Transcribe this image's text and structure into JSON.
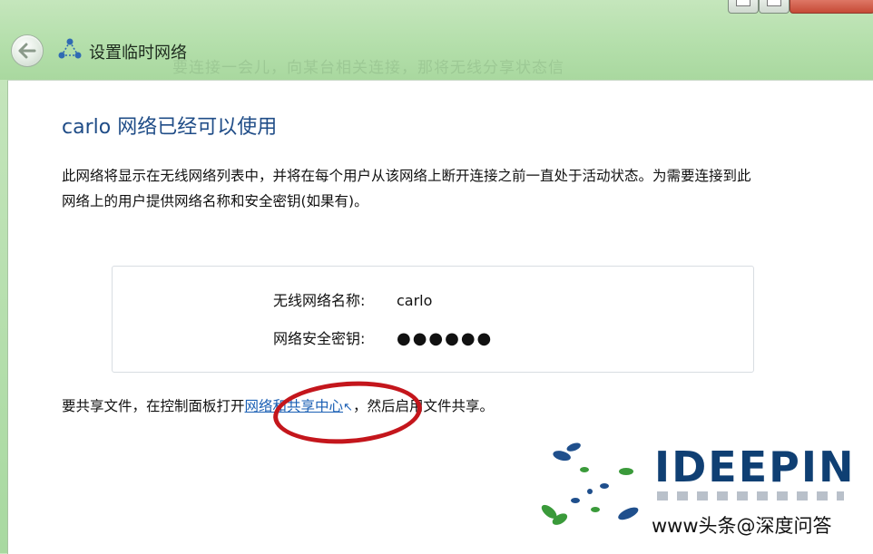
{
  "window": {
    "title": "设置临时网络",
    "background_hint": "要连接一会儿，向某台相关连接，那将无线分享状态信"
  },
  "main": {
    "heading": "carlo 网络已经可以使用",
    "description": "此网络将显示在无线网络列表中，并将在每个用户从该网络上断开连接之前一直处于活动状态。为需要连接到此网络上的用户提供网络名称和安全密钥(如果有)。",
    "info": {
      "network_name_label": "无线网络名称:",
      "network_name_value": "carlo",
      "security_key_label": "网络安全密钥:",
      "security_key_value": "●●●●●●"
    },
    "share": {
      "prefix": "要共享文件，在控制面板打开",
      "link": "网络和共享中心",
      "suffix": "，然后启用文件共享。"
    }
  },
  "watermark": {
    "brand": "IDEEPIN",
    "site": "www头条@深度问答"
  },
  "colors": {
    "heading": "#1f4c87",
    "link": "#1a5fb4",
    "highlight_circle": "#c4161c",
    "brand": "#0f3f73"
  }
}
